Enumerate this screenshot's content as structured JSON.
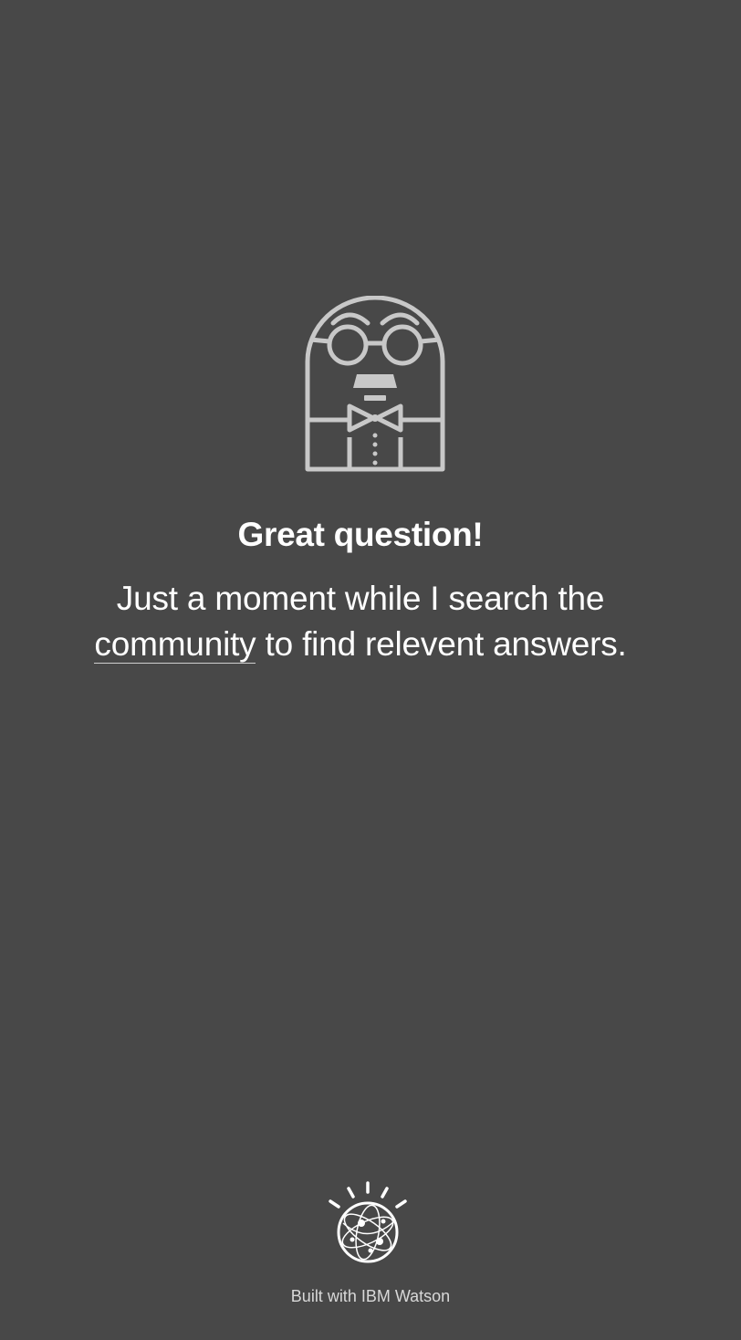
{
  "content": {
    "headline": "Great question!",
    "message_line1": "Just a moment while I search the",
    "message_link": "community",
    "message_line2_rest": " to find relevent answers."
  },
  "footer": {
    "branding": "Built with IBM Watson"
  },
  "colors": {
    "background": "#484848",
    "text": "#ffffff",
    "icon_stroke": "#c8c8c8",
    "footer_text": "#d8d8d8"
  },
  "icons": {
    "mascot": "bowtie-owl-mascot-icon",
    "watson": "ibm-watson-logo-icon"
  }
}
